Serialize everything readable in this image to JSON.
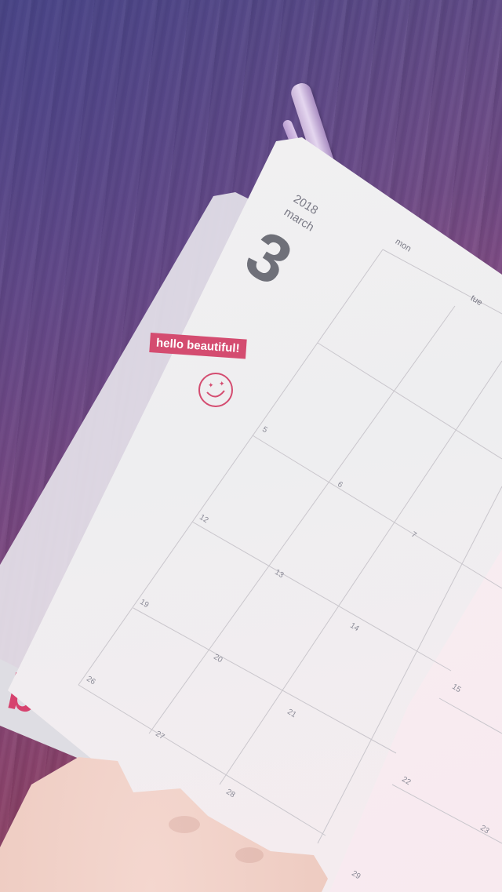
{
  "planner": {
    "year": "2018",
    "month": "march",
    "month_number": "3",
    "weekdays": [
      "mon",
      "tue"
    ],
    "banner": "hello beautiful!",
    "dates": [
      "5",
      "6",
      "7",
      "12",
      "13",
      "14",
      "15",
      "19",
      "20",
      "21",
      "22",
      "23",
      "26",
      "27",
      "28",
      "29"
    ]
  },
  "colors": {
    "accent": "#d44c70",
    "ink": "#6f7079"
  },
  "icons": [
    "smiley-icon",
    "pen"
  ]
}
